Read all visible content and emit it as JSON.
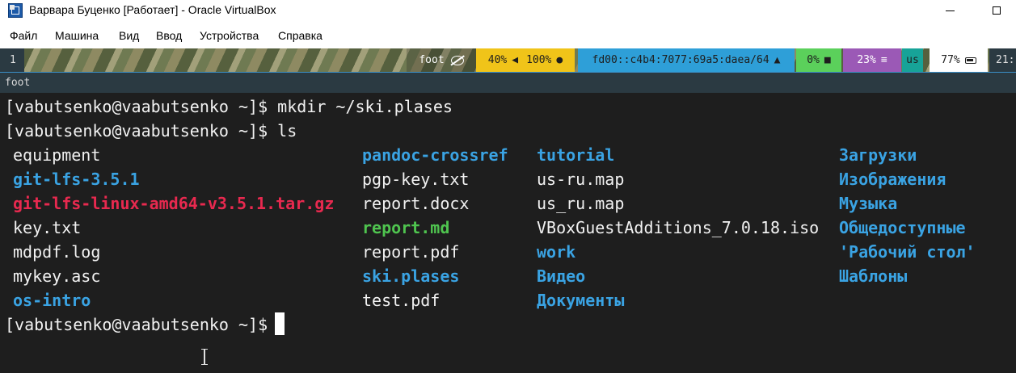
{
  "window": {
    "title": "Варвара Буценко [Работает] - Oracle VirtualBox",
    "app_icon": "virtualbox-icon"
  },
  "menu": {
    "items": [
      "Файл",
      "Машина",
      "Вид",
      "Ввод",
      "Устройства",
      "Справка"
    ]
  },
  "waybar": {
    "workspace": "1",
    "window_name": "foot",
    "window_icon": "eye-slash-icon",
    "volume": "40%",
    "volume_icon": "speaker-icon",
    "mic": "100%",
    "mic_icon": "microphone-icon",
    "network": "fd00::c4b4:7077:69a5:daea/64",
    "network_icon": "network-icon",
    "cpu": "0%",
    "cpu_icon": "cpu-icon",
    "memory": "23%",
    "memory_icon": "memory-icon",
    "language": "us",
    "battery": "77%",
    "battery_icon": "battery-icon",
    "clock": "21:",
    "colors": {
      "audio": "#f0c419",
      "network": "#2e9fd8",
      "cpu": "#5bd05b",
      "memory": "#9b59b6",
      "language": "#17a398"
    }
  },
  "foot_window": {
    "title": "foot"
  },
  "terminal": {
    "prompt": "[vabutsenko@vaabutsenko ~]$",
    "commands": [
      "mkdir ~/ski.plases",
      "ls",
      ""
    ],
    "ls_columns": [
      [
        {
          "name": "equipment",
          "type": "file"
        },
        {
          "name": "git-lfs-3.5.1",
          "type": "dir"
        },
        {
          "name": "git-lfs-linux-amd64-v3.5.1.tar.gz",
          "type": "archive"
        },
        {
          "name": "key.txt",
          "type": "file"
        },
        {
          "name": "mdpdf.log",
          "type": "file"
        },
        {
          "name": "mykey.asc",
          "type": "file"
        },
        {
          "name": "os-intro",
          "type": "dir"
        }
      ],
      [
        {
          "name": "pandoc-crossref",
          "type": "dir"
        },
        {
          "name": "pgp-key.txt",
          "type": "file"
        },
        {
          "name": "report.docx",
          "type": "file"
        },
        {
          "name": "report.md",
          "type": "exec"
        },
        {
          "name": "report.pdf",
          "type": "file"
        },
        {
          "name": "ski.plases",
          "type": "dir"
        },
        {
          "name": "test.pdf",
          "type": "file"
        }
      ],
      [
        {
          "name": "tutorial",
          "type": "dir"
        },
        {
          "name": "us-ru.map",
          "type": "file"
        },
        {
          "name": "us_ru.map",
          "type": "file"
        },
        {
          "name": "VBoxGuestAdditions_7.0.18.iso",
          "type": "file"
        },
        {
          "name": "work",
          "type": "dir"
        },
        {
          "name": "Видео",
          "type": "dir"
        },
        {
          "name": "Документы",
          "type": "dir"
        }
      ],
      [
        {
          "name": "Загрузки",
          "type": "dir"
        },
        {
          "name": "Изображения",
          "type": "dir"
        },
        {
          "name": "Музыка",
          "type": "dir"
        },
        {
          "name": "Общедоступные",
          "type": "dir"
        },
        {
          "name": "'Рабочий стол'",
          "type": "dir"
        },
        {
          "name": "Шаблоны",
          "type": "dir"
        }
      ]
    ],
    "colors": {
      "dir": "#3aa3e3",
      "archive": "#e8294f",
      "exec": "#4fc44f",
      "file": "#f2f2f2"
    }
  }
}
